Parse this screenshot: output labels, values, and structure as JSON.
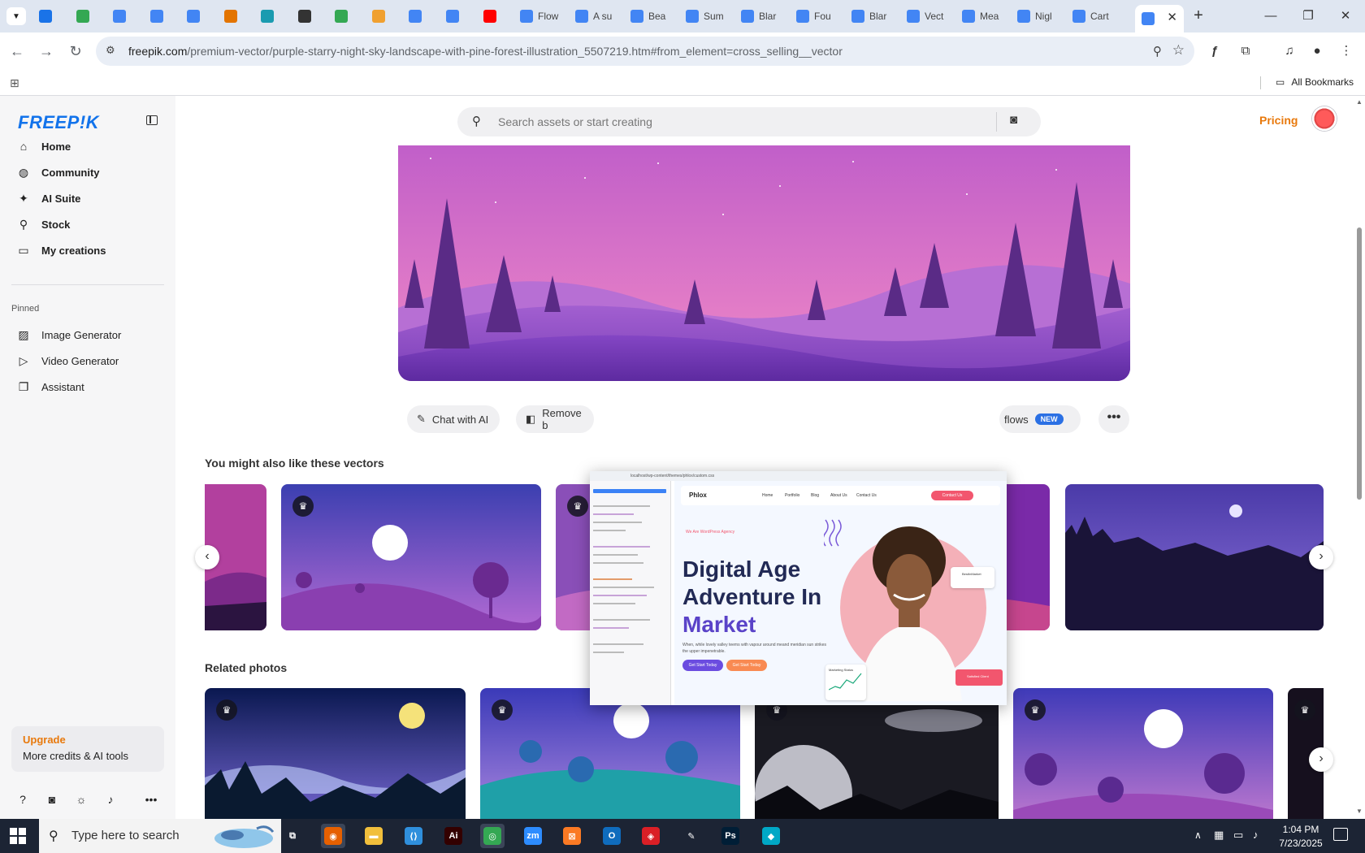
{
  "browser": {
    "tabs": [
      {
        "title": "",
        "color": "#1a73e8"
      },
      {
        "title": "",
        "color": "#34a853"
      },
      {
        "title": "",
        "color": "#4285f4"
      },
      {
        "title": "",
        "color": "#4285f4"
      },
      {
        "title": "",
        "color": "#4285f4"
      },
      {
        "title": "",
        "color": "#e37400"
      },
      {
        "title": "",
        "color": "#1a9bb0"
      },
      {
        "title": "",
        "color": "#333333"
      },
      {
        "title": "",
        "color": "#34a853"
      },
      {
        "title": "",
        "color": "#f0a030"
      },
      {
        "title": "",
        "color": "#4285f4"
      },
      {
        "title": "",
        "color": "#4285f4"
      },
      {
        "title": "",
        "color": "#ff0000"
      },
      {
        "title": "Flow",
        "color": "#4285f4"
      },
      {
        "title": "A su",
        "color": "#4285f4"
      },
      {
        "title": "Bea",
        "color": "#4285f4"
      },
      {
        "title": "Sum",
        "color": "#4285f4"
      },
      {
        "title": "Blar",
        "color": "#4285f4"
      },
      {
        "title": "Fou",
        "color": "#4285f4"
      },
      {
        "title": "Blar",
        "color": "#4285f4"
      },
      {
        "title": "Vect",
        "color": "#4285f4"
      },
      {
        "title": "Mea",
        "color": "#4285f4"
      },
      {
        "title": "Nigl",
        "color": "#4285f4"
      },
      {
        "title": "Cart",
        "color": "#4285f4"
      }
    ],
    "active_tab_color": "#4285f4",
    "new_tab_symbol": "+",
    "url_host": "freepik.com",
    "url_path": "/premium-vector/purple-starry-night-sky-landscape-with-pine-forest-illustration_5507219.htm#from_element=cross_selling__vector",
    "all_bookmarks": "All Bookmarks"
  },
  "sidebar": {
    "logo": "FREEP!K",
    "nav": [
      {
        "label": "Home",
        "icon": "home-icon",
        "glyph": "⌂"
      },
      {
        "label": "Community",
        "icon": "globe-icon",
        "glyph": "◍"
      },
      {
        "label": "AI Suite",
        "icon": "sparkle-icon",
        "glyph": "✦"
      },
      {
        "label": "Stock",
        "icon": "search-icon",
        "glyph": "⚲"
      },
      {
        "label": "My creations",
        "icon": "folder-icon",
        "glyph": "▭"
      }
    ],
    "pinned_label": "Pinned",
    "pinned": [
      {
        "label": "Image Generator",
        "icon": "image-icon",
        "glyph": "▨"
      },
      {
        "label": "Video Generator",
        "icon": "video-icon",
        "glyph": "▷"
      },
      {
        "label": "Assistant",
        "icon": "chat-icon",
        "glyph": "❐"
      }
    ],
    "upgrade_title": "Upgrade",
    "upgrade_sub": "More credits & AI tools"
  },
  "header": {
    "search_placeholder": "Search assets or start creating",
    "pricing": "Pricing"
  },
  "actions": {
    "chat": "Chat with AI",
    "remove": "Remove b",
    "workflows": "flows",
    "new_badge": "NEW",
    "more": "•••"
  },
  "sections": {
    "vectors_title": "You might also like these vectors",
    "photos_title": "Related photos"
  },
  "preview": {
    "address": "localhost/wp-content/themes/phlox/custom.css",
    "logo": "Phlox",
    "nav_links": [
      "Home",
      "Portfolio",
      "Blog",
      "About Us",
      "Contact Us"
    ],
    "contact_btn": "Contact Us",
    "tagline": "We Are WordPress Agency",
    "headline_1": "Digital Age",
    "headline_2": "Adventure In",
    "headline_3": "Market",
    "paragraph": "When, while lovely valley teems with vapour around meand meridian sun strikes the upper impenetrable.",
    "btn_primary": "Get Start Today",
    "btn_secondary": "Get Start Today",
    "badge": "BestInMarket",
    "stat": "Marketing Status",
    "red_card": "Satisfied Client"
  },
  "taskbar": {
    "search_text": "Type here to search",
    "time": "1:04 PM",
    "date": "7/23/2025",
    "apps": [
      {
        "name": "task-view",
        "label": "⧉",
        "color": "transparent"
      },
      {
        "name": "firefox",
        "label": "◉",
        "color": "#e66000"
      },
      {
        "name": "file-explorer",
        "label": "▬",
        "color": "#f1bf3c"
      },
      {
        "name": "vscode",
        "label": "⟨⟩",
        "color": "#2f8fdc"
      },
      {
        "name": "illustrator",
        "label": "Ai",
        "color": "#330000"
      },
      {
        "name": "chrome",
        "label": "◎",
        "color": "#34a853"
      },
      {
        "name": "zoom",
        "label": "zm",
        "color": "#2d8cff"
      },
      {
        "name": "xampp",
        "label": "⊠",
        "color": "#fb7a24"
      },
      {
        "name": "outlook",
        "label": "O",
        "color": "#0f6cbd"
      },
      {
        "name": "creative-cloud",
        "label": "◈",
        "color": "#da1f26"
      },
      {
        "name": "pen-tool",
        "label": "✎",
        "color": "transparent"
      },
      {
        "name": "photoshop",
        "label": "Ps",
        "color": "#001e36"
      },
      {
        "name": "app-diamond",
        "label": "◆",
        "color": "#00a8c6"
      }
    ]
  }
}
